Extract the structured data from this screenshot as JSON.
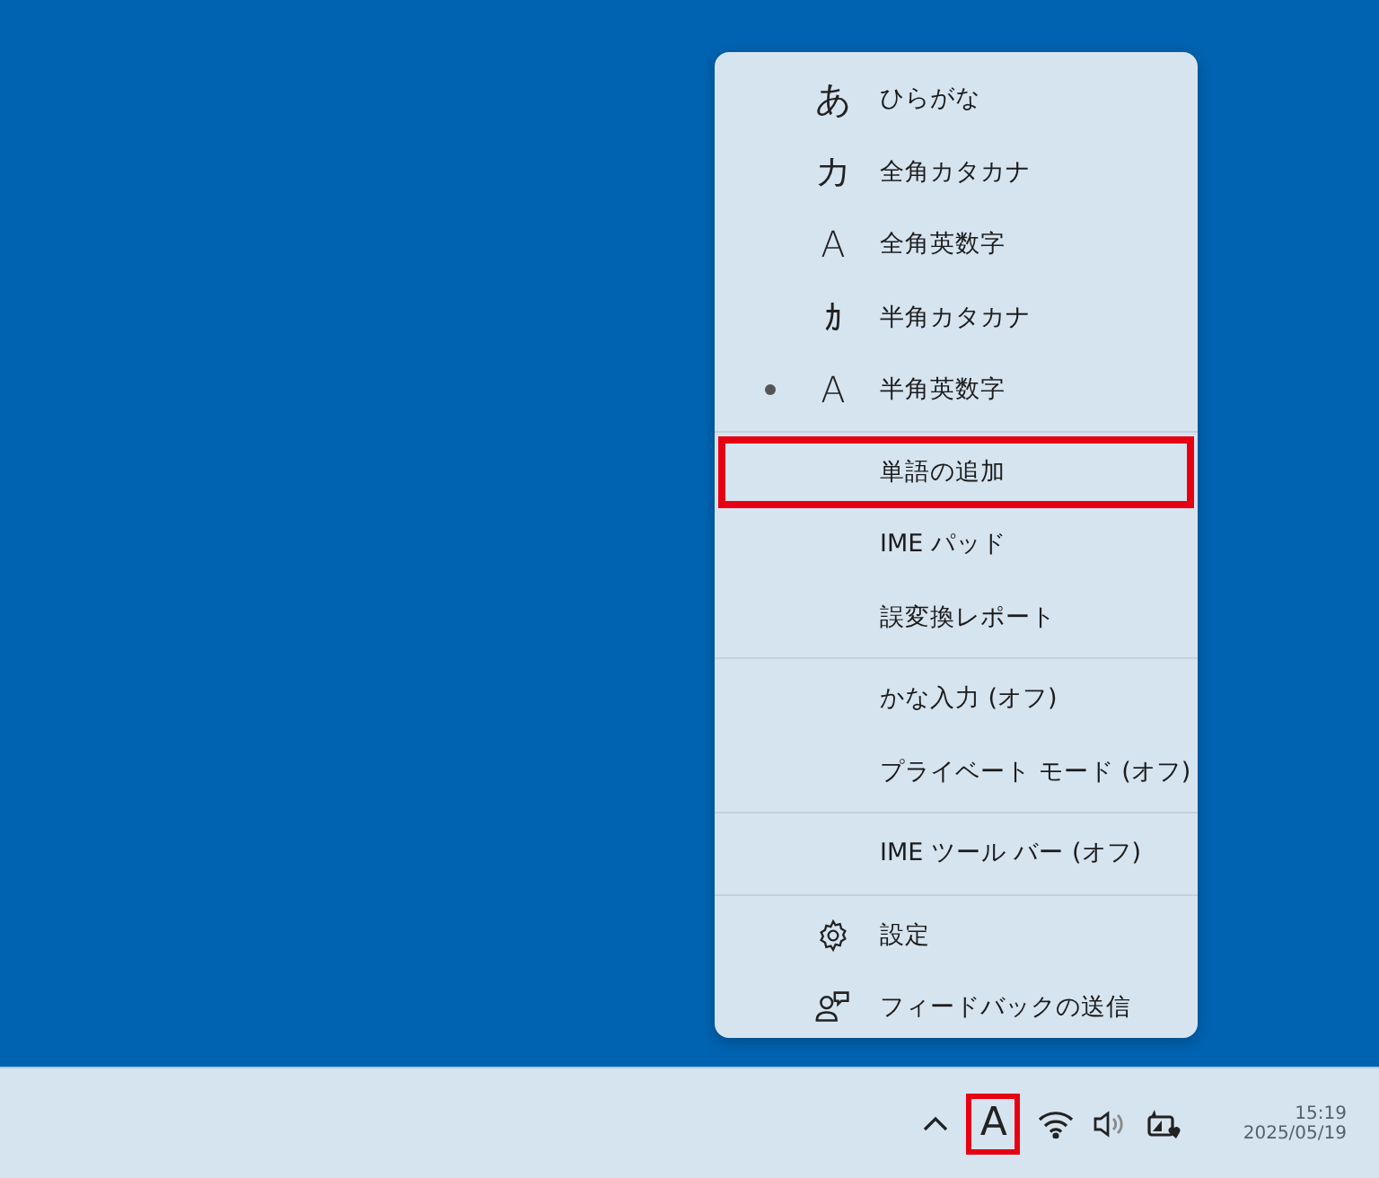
{
  "menu": {
    "sections": [
      {
        "items": [
          {
            "kind": "glyph",
            "glyph": "あ",
            "label": "ひらがな",
            "selected": false,
            "highlighted": false
          },
          {
            "kind": "glyph",
            "glyph": "カ",
            "label": "全角カタカナ",
            "selected": false,
            "highlighted": false
          },
          {
            "kind": "glyph",
            "glyph": "A",
            "label": "全角英数字",
            "selected": false,
            "highlighted": false
          },
          {
            "kind": "glyph",
            "glyph": "ｶ",
            "label": "半角カタカナ",
            "selected": false,
            "highlighted": false
          },
          {
            "kind": "glyph",
            "glyph": "A",
            "label": "半角英数字",
            "selected": true,
            "highlighted": false
          }
        ]
      },
      {
        "items": [
          {
            "kind": "plain",
            "label": "単語の追加",
            "selected": false,
            "highlighted": true
          },
          {
            "kind": "plain",
            "label": "IME パッド",
            "selected": false,
            "highlighted": false
          },
          {
            "kind": "plain",
            "label": "誤変換レポート",
            "selected": false,
            "highlighted": false
          }
        ]
      },
      {
        "items": [
          {
            "kind": "plain",
            "label": "かな入力 (オフ)",
            "selected": false,
            "highlighted": false
          },
          {
            "kind": "plain",
            "label": "プライベート モード (オフ)",
            "selected": false,
            "highlighted": false
          }
        ]
      },
      {
        "items": [
          {
            "kind": "plain",
            "label": "IME ツール バー (オフ)",
            "selected": false,
            "highlighted": false
          }
        ]
      },
      {
        "items": [
          {
            "kind": "gear",
            "label": "設定",
            "selected": false,
            "highlighted": false
          },
          {
            "kind": "feedback",
            "label": "フィードバックの送信",
            "selected": false,
            "highlighted": false
          }
        ]
      }
    ]
  },
  "taskbar": {
    "ime_indicator": {
      "glyph": "A",
      "highlighted": true
    },
    "clock": {
      "time": "15:19",
      "date": "2025/05/19"
    }
  }
}
